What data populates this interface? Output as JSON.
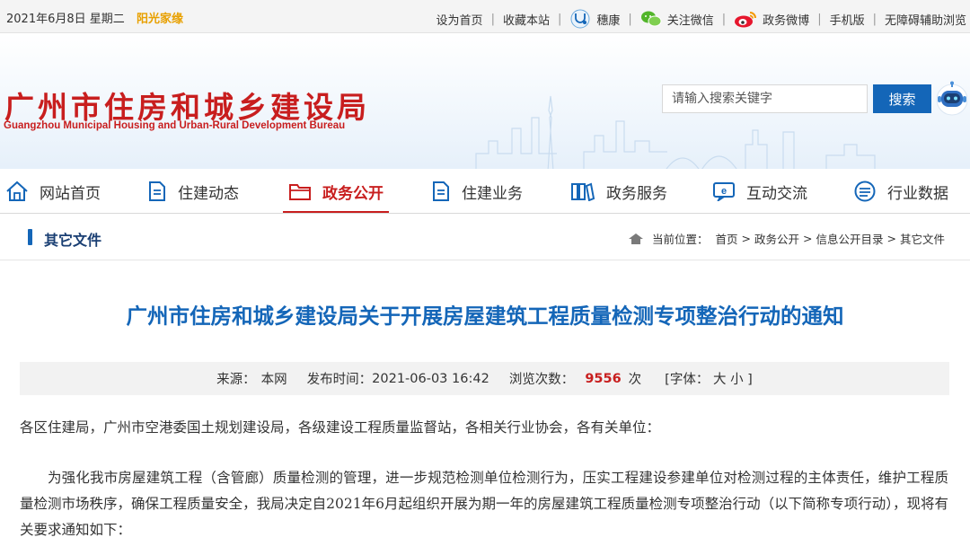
{
  "topbar": {
    "date": "2021年6月8日 星期二",
    "sunshine": "阳光家缘",
    "links": {
      "home": "设为首页",
      "fav": "收藏本站",
      "suikang": "穗康",
      "wechat": "关注微信",
      "weibo": "政务微博",
      "mobile": "手机版",
      "accessible": "无障碍辅助浏览"
    }
  },
  "header": {
    "title_cn": "广州市住房和城乡建设局",
    "title_en": "Guangzhou Municipal Housing and Urban-Rural Development Bureau",
    "search_placeholder": "请输入搜索关键字",
    "search_button": "搜索"
  },
  "nav": {
    "items": [
      {
        "label": "网站首页",
        "icon": "home-icon"
      },
      {
        "label": "住建动态",
        "icon": "document-icon"
      },
      {
        "label": "政务公开",
        "icon": "folder-icon"
      },
      {
        "label": "住建业务",
        "icon": "document-icon"
      },
      {
        "label": "政务服务",
        "icon": "books-icon"
      },
      {
        "label": "互动交流",
        "icon": "chat-icon"
      },
      {
        "label": "行业数据",
        "icon": "database-icon"
      }
    ],
    "active_index": 2
  },
  "crumbbar": {
    "section_title": "其它文件",
    "location_label": "当前位置：",
    "crumbs": [
      "首页",
      "政务公开",
      "信息公开目录",
      "其它文件"
    ]
  },
  "article": {
    "title": "广州市住房和城乡建设局关于开展房屋建筑工程质量检测专项整治行动的通知",
    "meta": {
      "source_label": "来源：",
      "source": "本网",
      "publish_label": "发布时间：",
      "publish_time": "2021-06-03 16:42",
      "views_label": "浏览次数：",
      "views": "9556",
      "views_unit": "次",
      "font_label": "[字体：",
      "font_large": "大",
      "font_small": "小 ]"
    },
    "paragraphs": [
      "各区住建局，广州市空港委国土规划建设局，各级建设工程质量监督站，各相关行业协会，各有关单位：",
      "为强化我市房屋建筑工程（含管廊）质量检测的管理，进一步规范检测单位检测行为，压实工程建设参建单位对检测过程的主体责任，维护工程质量检测市场秩序，确保工程质量安全，我局决定自2021年6月起组织开展为期一年的房屋建筑工程质量检测专项整治行动（以下简称专项行动），现将有关要求通知如下："
    ]
  },
  "colors": {
    "brand_red": "#c81e1e",
    "brand_blue": "#1466b8",
    "accent_orange": "#e8a000"
  }
}
